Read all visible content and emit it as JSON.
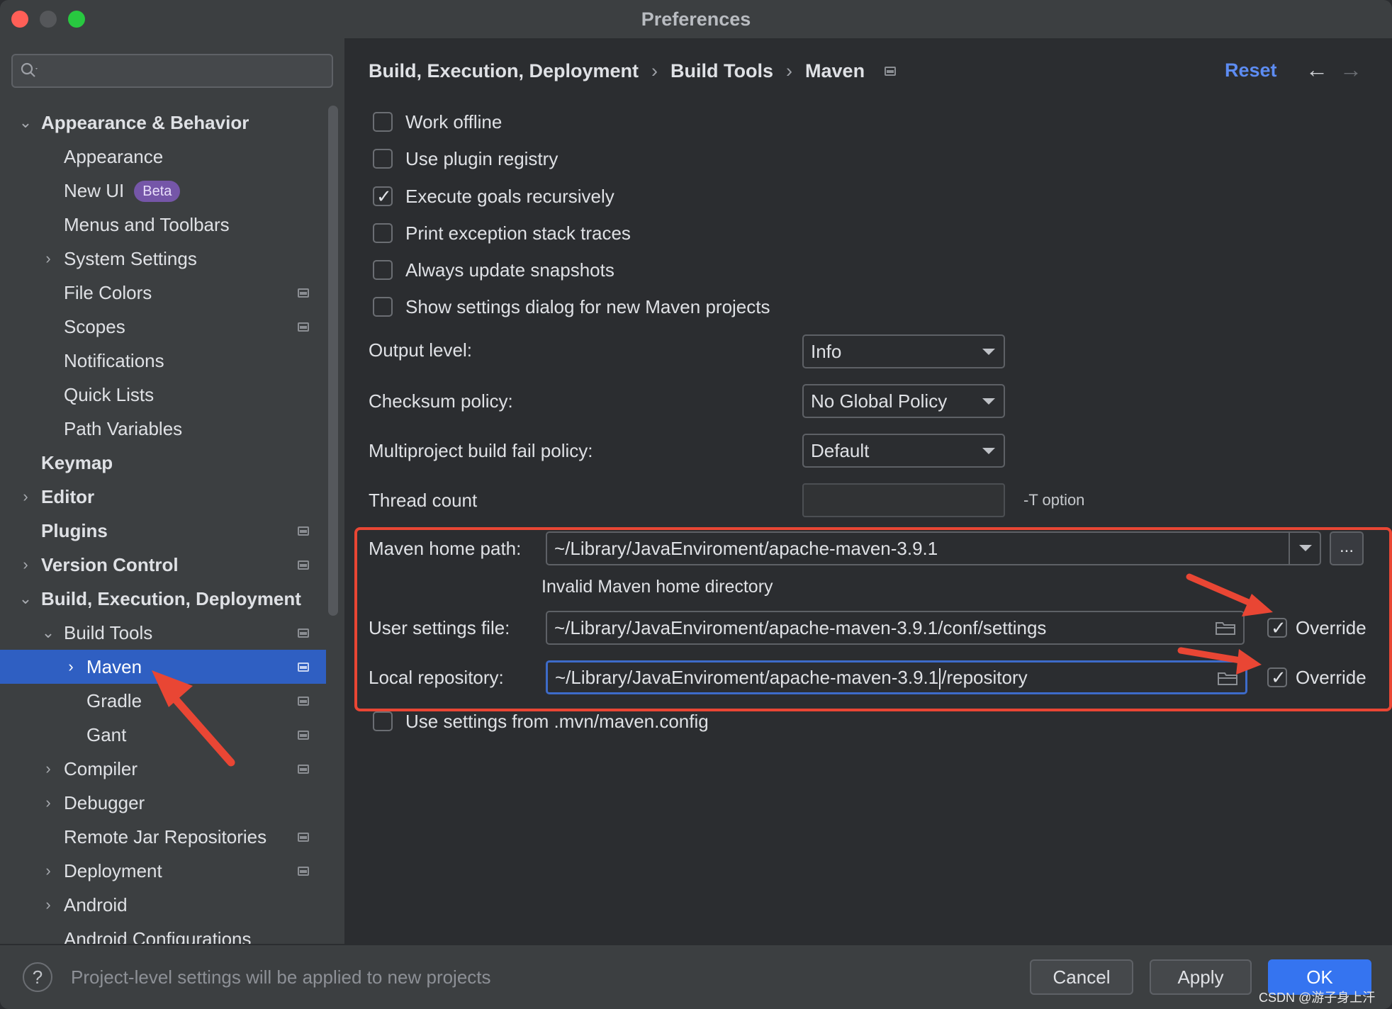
{
  "window": {
    "title": "Preferences"
  },
  "sidebar": {
    "items": [
      {
        "label": "Appearance & Behavior",
        "expanded": true,
        "bold": true
      },
      {
        "label": "Appearance"
      },
      {
        "label": "New UI",
        "badge": "Beta"
      },
      {
        "label": "Menus and Toolbars"
      },
      {
        "label": "System Settings"
      },
      {
        "label": "File Colors"
      },
      {
        "label": "Scopes"
      },
      {
        "label": "Notifications"
      },
      {
        "label": "Quick Lists"
      },
      {
        "label": "Path Variables"
      },
      {
        "label": "Keymap",
        "bold": true
      },
      {
        "label": "Editor",
        "bold": true
      },
      {
        "label": "Plugins",
        "bold": true
      },
      {
        "label": "Version Control",
        "bold": true
      },
      {
        "label": "Build, Execution, Deployment",
        "expanded": true,
        "bold": true
      },
      {
        "label": "Build Tools",
        "expanded": true
      },
      {
        "label": "Maven",
        "selected": true
      },
      {
        "label": "Gradle"
      },
      {
        "label": "Gant"
      },
      {
        "label": "Compiler"
      },
      {
        "label": "Debugger"
      },
      {
        "label": "Remote Jar Repositories"
      },
      {
        "label": "Deployment"
      },
      {
        "label": "Android"
      },
      {
        "label": "Android Configurations"
      }
    ]
  },
  "breadcrumb": [
    "Build, Execution, Deployment",
    "Build Tools",
    "Maven"
  ],
  "header": {
    "reset_label": "Reset",
    "back_icon": "arrow-left-icon",
    "forward_icon": "arrow-right-icon"
  },
  "options": {
    "work_offline": {
      "label": "Work offline",
      "checked": false
    },
    "use_plugin_registry": {
      "label": "Use plugin registry",
      "checked": false
    },
    "execute_goals_recursively": {
      "label": "Execute goals recursively",
      "checked": true
    },
    "print_exception_stack_traces": {
      "label": "Print exception stack traces",
      "checked": false
    },
    "always_update_snapshots": {
      "label": "Always update snapshots",
      "checked": false
    },
    "show_settings_dialog": {
      "label": "Show settings dialog for new Maven projects",
      "checked": false
    },
    "use_mvn_config": {
      "label": "Use settings from .mvn/maven.config",
      "checked": false
    }
  },
  "fields": {
    "output_level": {
      "label": "Output level:",
      "value": "Info"
    },
    "checksum_policy": {
      "label": "Checksum policy:",
      "value": "No Global Policy"
    },
    "multiproject_fail_policy": {
      "label": "Multiproject build fail policy:",
      "value": "Default"
    },
    "thread_count": {
      "label": "Thread count",
      "value": "",
      "hint": "-T option"
    },
    "maven_home_path": {
      "label": "Maven home path:",
      "value": "~/Library/JavaEnviroment/apache-maven-3.9.1",
      "more_label": "...",
      "error": "Invalid Maven home directory"
    },
    "user_settings_file": {
      "label": "User settings file:",
      "value": "~/Library/JavaEnviroment/apache-maven-3.9.1/conf/settings",
      "override_label": "Override",
      "override_checked": true
    },
    "local_repository": {
      "label": "Local repository:",
      "value_before_caret": "~/Library/JavaEnviroment/apache-maven-3.9.1",
      "value_after_caret": "/repository",
      "override_label": "Override",
      "override_checked": true
    }
  },
  "footer": {
    "help_label": "?",
    "message": "Project-level settings will be applied to new projects",
    "cancel_label": "Cancel",
    "apply_label": "Apply",
    "ok_label": "OK",
    "watermark": "CSDN @游子身上汗"
  },
  "colors": {
    "accent": "#3574f0",
    "selection": "#2f5fc2",
    "annotation_red": "#e94634",
    "link": "#5d8cf2"
  }
}
